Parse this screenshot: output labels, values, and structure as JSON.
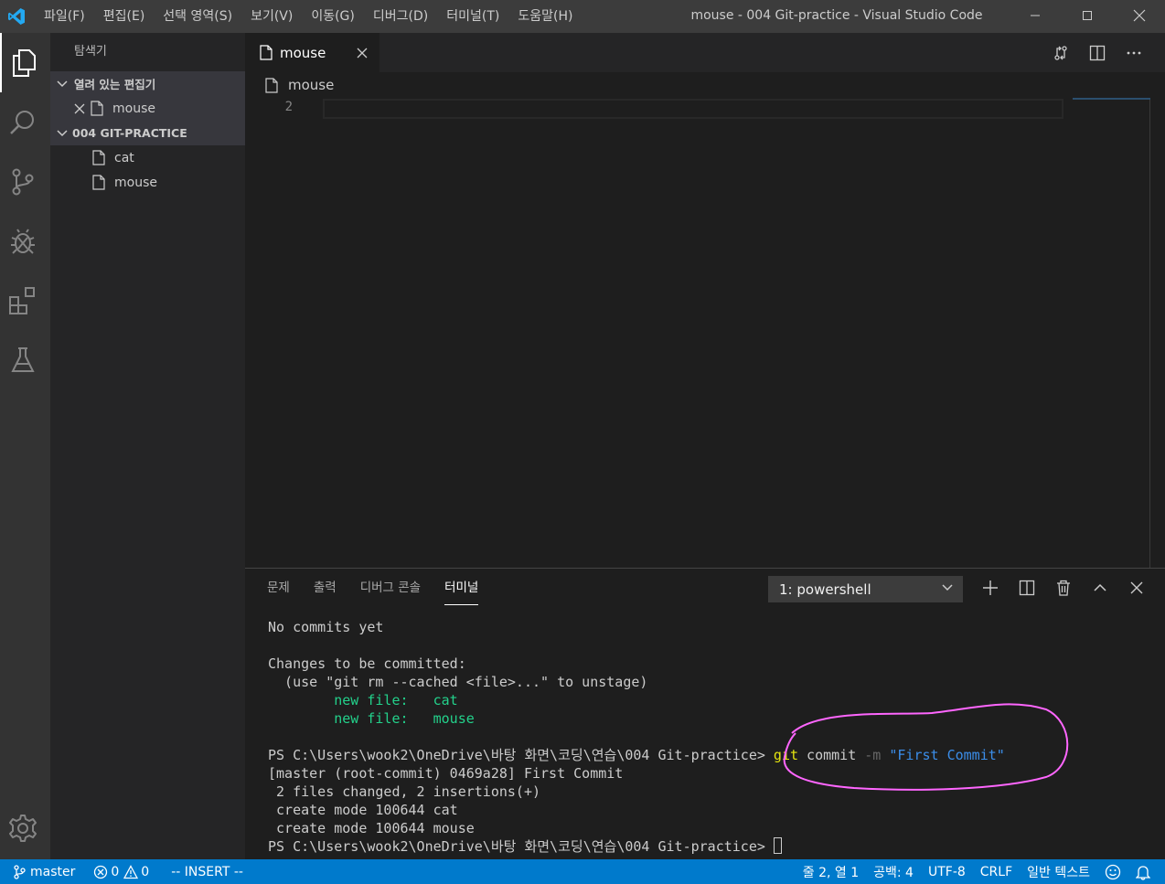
{
  "titlebar": {
    "menu": [
      "파일(F)",
      "편집(E)",
      "선택 영역(S)",
      "보기(V)",
      "이동(G)",
      "디버그(D)",
      "터미널(T)",
      "도움말(H)"
    ],
    "title": "mouse - 004 Git-practice - Visual Studio Code"
  },
  "sidebar": {
    "title": "탐색기",
    "open_editors_label": "열려 있는 편집기",
    "open_editors": [
      {
        "name": "mouse"
      }
    ],
    "folder_label": "004 GIT-PRACTICE",
    "files": [
      {
        "name": "cat"
      },
      {
        "name": "mouse"
      }
    ]
  },
  "editor": {
    "tab_label": "mouse",
    "breadcrumb": "mouse",
    "line_number": "2"
  },
  "panel": {
    "tabs": [
      "문제",
      "출력",
      "디버그 콘솔",
      "터미널"
    ],
    "active_tab": "터미널",
    "terminal_select": "1: powershell",
    "terminal": {
      "l1": "No commits yet",
      "l2": "Changes to be committed:",
      "l3": "  (use \"git rm --cached <file>...\" to unstage)",
      "l4_label": "        new file:   ",
      "l4_file": "cat",
      "l5_label": "        new file:   ",
      "l5_file": "mouse",
      "prompt": "PS C:\\Users\\wook2\\OneDrive\\바탕 화면\\코딩\\연습\\004 Git-practice> ",
      "cmd_git": "git",
      "cmd_commit": " commit ",
      "cmd_flag": "-m",
      "cmd_msg": " \"First Commit\"",
      "l7": "[master (root-commit) 0469a28] First Commit",
      "l8": " 2 files changed, 2 insertions(+)",
      "l9": " create mode 100644 cat",
      "l10": " create mode 100644 mouse",
      "prompt2": "PS C:\\Users\\wook2\\OneDrive\\바탕 화면\\코딩\\연습\\004 Git-practice> "
    }
  },
  "statusbar": {
    "branch": "master",
    "errors": "0",
    "warnings": "0",
    "mode": "-- INSERT --",
    "position": "줄 2, 열 1",
    "spaces": "공백: 4",
    "encoding": "UTF-8",
    "eol": "CRLF",
    "language": "일반 텍스트"
  },
  "colors": {
    "statusbar": "#007acc",
    "annotation": "#ff66ff",
    "terminal_green": "#23d18b",
    "terminal_yellow": "#e5e510"
  }
}
